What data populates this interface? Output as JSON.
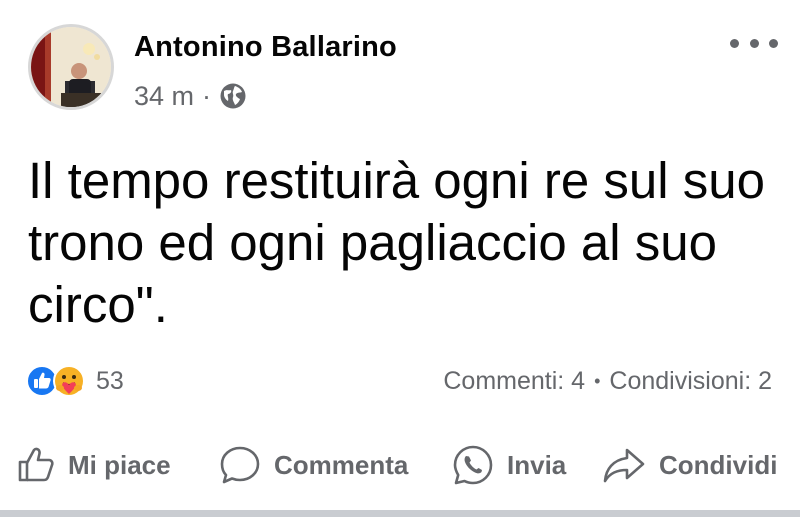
{
  "post": {
    "author": "Antonino Ballarino",
    "time": "34 m",
    "separator": "·",
    "privacy_icon": "globe-icon",
    "more_icon": "more-options-icon",
    "text": "Il tempo restituirà ogni re sul suo trono ed ogni pagliaccio al suo circo\"."
  },
  "reactions": {
    "icons": [
      "like-reaction-icon",
      "care-reaction-icon"
    ],
    "count": "53",
    "comments": "Commenti: 4",
    "stats_separator": "•",
    "shares": "Condivisioni: 2"
  },
  "actions": {
    "like": "Mi piace",
    "comment": "Commenta",
    "send": "Invia",
    "share": "Condividi"
  },
  "colors": {
    "text": "#050505",
    "secondary": "#65676b",
    "like_blue": "#1877f2",
    "divider": "#c9ccd1"
  }
}
